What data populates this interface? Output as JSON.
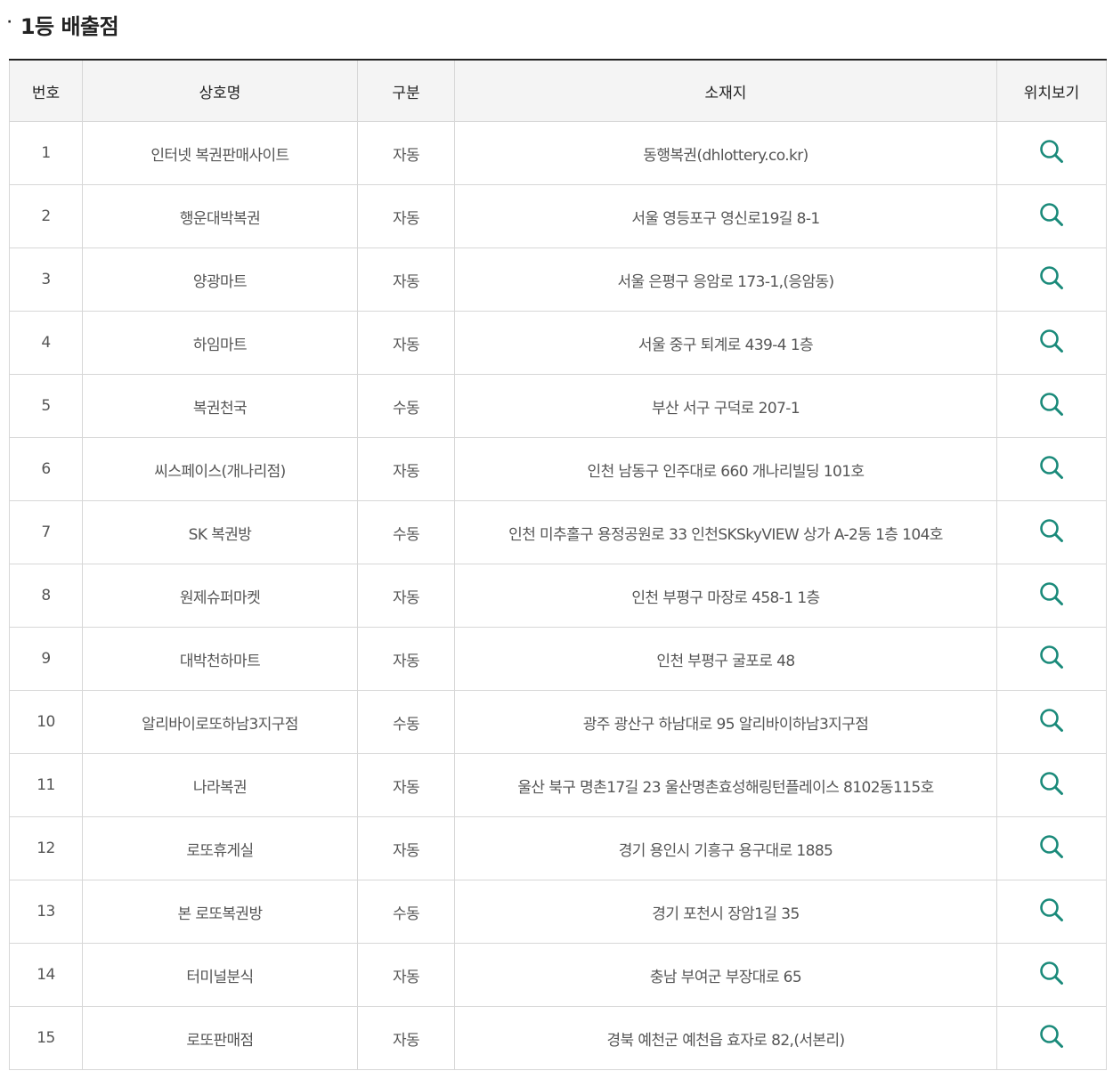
{
  "section": {
    "bullet": "·",
    "title": "1등 배출점"
  },
  "table": {
    "headers": {
      "no": "번호",
      "name": "상호명",
      "type": "구분",
      "address": "소재지",
      "map": "위치보기"
    },
    "map_icon": "search-icon",
    "accent_color": "#1a8a7a",
    "rows": [
      {
        "no": "1",
        "name": "인터넷 복권판매사이트",
        "type": "자동",
        "address": "동행복권(dhlottery.co.kr)"
      },
      {
        "no": "2",
        "name": "행운대박복권",
        "type": "자동",
        "address": "서울 영등포구 영신로19길 8-1"
      },
      {
        "no": "3",
        "name": "양광마트",
        "type": "자동",
        "address": "서울 은평구 응암로 173-1,(응암동)"
      },
      {
        "no": "4",
        "name": "하임마트",
        "type": "자동",
        "address": "서울 중구 퇴계로 439-4 1층"
      },
      {
        "no": "5",
        "name": "복권천국",
        "type": "수동",
        "address": "부산 서구 구덕로 207-1"
      },
      {
        "no": "6",
        "name": "씨스페이스(개나리점)",
        "type": "자동",
        "address": "인천 남동구 인주대로 660 개나리빌딩 101호"
      },
      {
        "no": "7",
        "name": "SK 복권방",
        "type": "수동",
        "address": "인천 미추홀구 용정공원로 33 인천SKSkyVIEW 상가 A-2동 1층 104호"
      },
      {
        "no": "8",
        "name": "원제슈퍼마켓",
        "type": "자동",
        "address": "인천 부평구 마장로 458-1 1층"
      },
      {
        "no": "9",
        "name": "대박천하마트",
        "type": "자동",
        "address": "인천 부평구 굴포로 48"
      },
      {
        "no": "10",
        "name": "알리바이로또하남3지구점",
        "type": "수동",
        "address": "광주 광산구 하남대로 95 알리바이하남3지구점"
      },
      {
        "no": "11",
        "name": "나라복권",
        "type": "자동",
        "address": "울산 북구 명촌17길 23 울산명촌효성해링턴플레이스 8102동115호"
      },
      {
        "no": "12",
        "name": "로또휴게실",
        "type": "자동",
        "address": "경기 용인시 기흥구 용구대로 1885"
      },
      {
        "no": "13",
        "name": "본 로또복권방",
        "type": "수동",
        "address": "경기 포천시 장암1길 35"
      },
      {
        "no": "14",
        "name": "터미널분식",
        "type": "자동",
        "address": "충남 부여군 부장대로 65"
      },
      {
        "no": "15",
        "name": "로또판매점",
        "type": "자동",
        "address": "경북 예천군 예천읍 효자로 82,(서본리)"
      }
    ]
  }
}
